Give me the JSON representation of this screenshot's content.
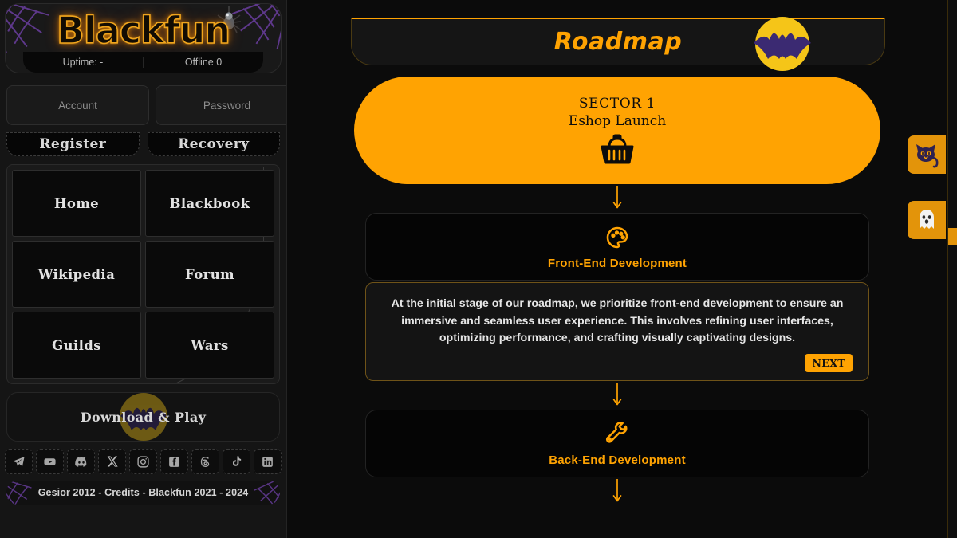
{
  "theme": {
    "accent": "#ffa302",
    "accent_dim": "#e3940a",
    "page_bg": "#0b0b0b",
    "sidebar_bg": "#151515",
    "card_bg": "#050505",
    "web_purple": "#6b3fa0",
    "bat_purple": "#3b2a72",
    "moon_yellow": "#f5c518",
    "text_light": "#e6e6e6"
  },
  "sidebar": {
    "logo": "Blackfun",
    "status": {
      "uptime": "Uptime: -",
      "online": "Offline 0"
    },
    "login": {
      "account_placeholder": "Account",
      "password_placeholder": "Password",
      "account_value": "",
      "password_value": "",
      "submit_icon": "login-icon"
    },
    "auth_links": [
      {
        "label": "Register",
        "name": "register-link"
      },
      {
        "label": "Recovery",
        "name": "recovery-link"
      }
    ],
    "nav": [
      {
        "label": "Home",
        "name": "nav-home"
      },
      {
        "label": "Blackbook",
        "name": "nav-blackbook"
      },
      {
        "label": "Wikipedia",
        "name": "nav-wikipedia"
      },
      {
        "label": "Forum",
        "name": "nav-forum"
      },
      {
        "label": "Guilds",
        "name": "nav-guilds"
      },
      {
        "label": "Wars",
        "name": "nav-wars"
      }
    ],
    "download_label": "Download & Play",
    "socials": [
      {
        "name": "telegram-icon",
        "label": "Telegram"
      },
      {
        "name": "youtube-icon",
        "label": "YouTube"
      },
      {
        "name": "discord-icon",
        "label": "Discord"
      },
      {
        "name": "x-icon",
        "label": "X"
      },
      {
        "name": "instagram-icon",
        "label": "Instagram"
      },
      {
        "name": "facebook-icon",
        "label": "Facebook"
      },
      {
        "name": "threads-icon",
        "label": "Threads"
      },
      {
        "name": "tiktok-icon",
        "label": "TikTok"
      },
      {
        "name": "linkedin-icon",
        "label": "LinkedIn"
      }
    ],
    "footer": "Gesior 2012 - Credits - Blackfun 2021 - 2024"
  },
  "main": {
    "header_title": "Roadmap",
    "header_icon": "bat-moon-icon",
    "sector": {
      "title": "SECTOR 1",
      "subtitle": "Eshop Launch",
      "icon": "shopping-basket-icon"
    },
    "stages": [
      {
        "label": "Front-End Development",
        "icon": "palette-icon",
        "description": "At the initial stage of our roadmap, we prioritize front-end development to ensure an immersive and seamless user experience. This involves refining user interfaces, optimizing performance, and crafting visually captivating designs.",
        "next_label": "NEXT"
      },
      {
        "label": "Back-End Development",
        "icon": "wrench-icon"
      }
    ]
  },
  "side_tabs": [
    {
      "name": "side-tab-cat",
      "icon": "black-cat-icon"
    },
    {
      "name": "side-tab-ghost",
      "icon": "ghost-icon"
    }
  ]
}
